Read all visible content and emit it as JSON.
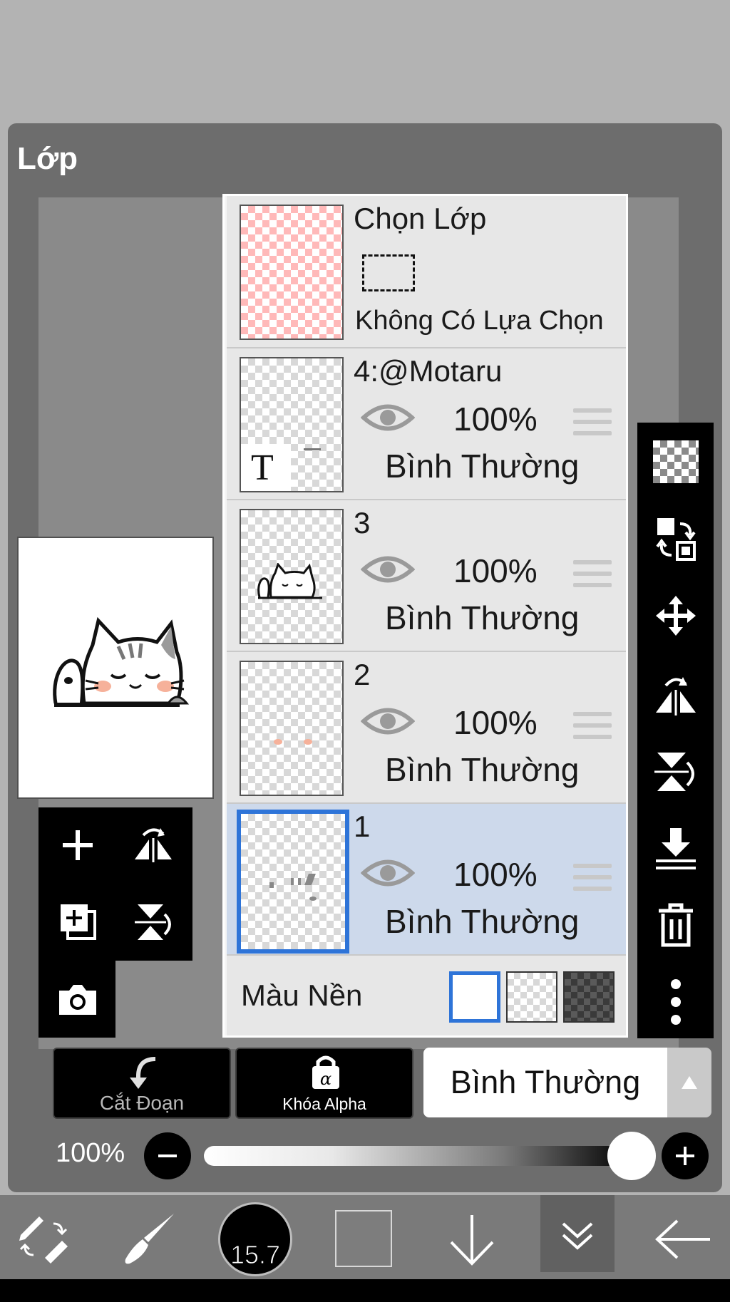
{
  "panel": {
    "title": "Lớp"
  },
  "selection_layer": {
    "title": "Chọn Lớp",
    "subtitle": "Không Có Lựa Chọn"
  },
  "layers": [
    {
      "name": "4:@Motaru",
      "opacity": "100%",
      "blend": "Bình Thường",
      "selected": false
    },
    {
      "name": "3",
      "opacity": "100%",
      "blend": "Bình Thường",
      "selected": false
    },
    {
      "name": "2",
      "opacity": "100%",
      "blend": "Bình Thường",
      "selected": false
    },
    {
      "name": "1",
      "opacity": "100%",
      "blend": "Bình Thường",
      "selected": true
    }
  ],
  "background": {
    "label": "Màu Nền",
    "options": [
      "white",
      "transparent",
      "dark-checker"
    ],
    "selected": "white"
  },
  "bottom_buttons": {
    "clip_label": "Cắt Đoạn",
    "alpha_lock_label": "Khóa Alpha",
    "blend_mode": "Bình Thường"
  },
  "opacity": {
    "label": "100%",
    "value": 1.0
  },
  "toolbar": {
    "brush_size": "15.7"
  },
  "colors": {
    "selection_blue": "#2e74d8",
    "selected_row": "#cdd9eb",
    "panel": "#6d6d6d"
  }
}
